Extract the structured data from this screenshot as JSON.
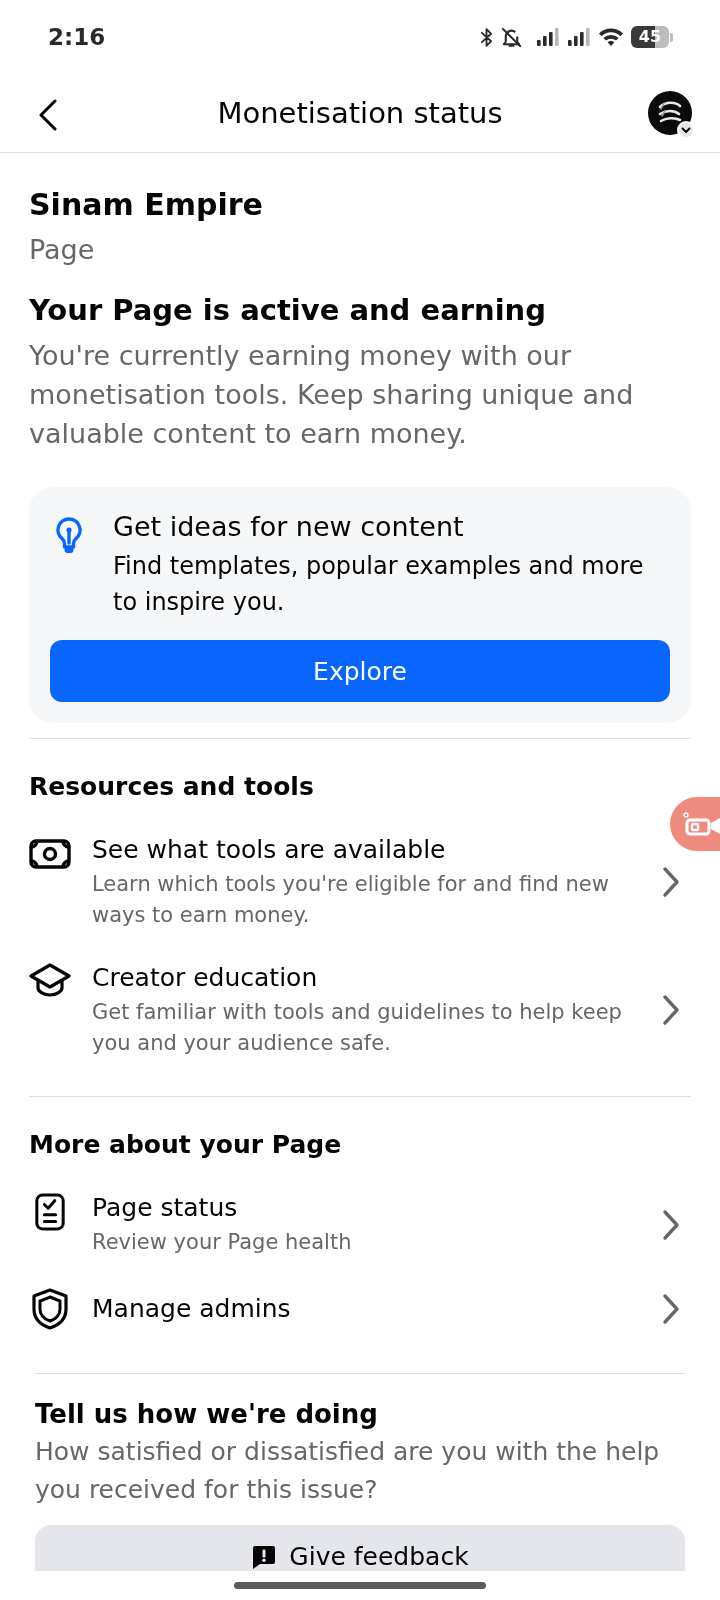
{
  "status_bar": {
    "time": "2:16",
    "battery": "45"
  },
  "header": {
    "title": "Monetisation status"
  },
  "page": {
    "name": "Sinam Empire",
    "type": "Page"
  },
  "status": {
    "title": "Your Page is active and earning",
    "description": "You're currently earning money with our monetisation tools. Keep sharing unique and valuable content to earn money."
  },
  "ideas_card": {
    "title": "Get ideas for new content",
    "description": "Find templates, popular examples and more to inspire you.",
    "button": "Explore"
  },
  "sections": [
    {
      "title": "Resources and tools",
      "items": [
        {
          "kind": "tools",
          "title": "See what tools are available",
          "description": "Learn which tools you're eligible for and find new ways to earn money."
        },
        {
          "kind": "education",
          "title": "Creator education",
          "description": "Get familiar with tools and guidelines to help keep you and your audience safe."
        }
      ]
    },
    {
      "title": "More about your Page",
      "items": [
        {
          "kind": "page_status",
          "title": "Page status",
          "description": "Review your Page health"
        },
        {
          "kind": "admins",
          "title": "Manage admins"
        }
      ]
    }
  ],
  "feedback": {
    "title": "Tell us how we're doing",
    "description": "How satisfied or dissatisfied are you with the help you received for this issue?",
    "button": "Give feedback"
  }
}
